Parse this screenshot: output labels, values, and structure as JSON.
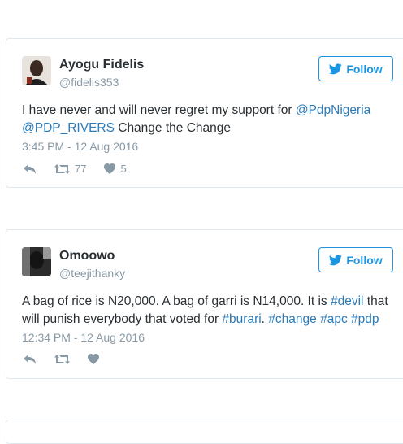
{
  "tweets": [
    {
      "name": "Ayogu Fidelis",
      "handle": "@fidelis353",
      "follow_label": "Follow",
      "text_parts": [
        {
          "t": "I have never and will never regret my support for ",
          "link": false
        },
        {
          "t": "@PdpNigeria",
          "link": true
        },
        {
          "t": " ",
          "link": false
        },
        {
          "t": "@PDP_RIVERS",
          "link": true
        },
        {
          "t": " Change the Change",
          "link": false
        }
      ],
      "time": "3:45 PM - 12 Aug 2016",
      "retweets": "77",
      "likes": "5"
    },
    {
      "name": "Omoowo",
      "handle": "@teejithanky",
      "follow_label": "Follow",
      "text_parts": [
        {
          "t": "A bag of rice is N20,000. A bag of garri is N14,000. It is ",
          "link": false
        },
        {
          "t": "#devil",
          "link": true
        },
        {
          "t": " that will punish everybody that voted for ",
          "link": false
        },
        {
          "t": "#burari",
          "link": true
        },
        {
          "t": ". ",
          "link": false
        },
        {
          "t": "#change",
          "link": true
        },
        {
          "t": " ",
          "link": false
        },
        {
          "t": "#apc",
          "link": true
        },
        {
          "t": " ",
          "link": false
        },
        {
          "t": "#pdp",
          "link": true
        }
      ],
      "time": "12:34 PM - 12 Aug 2016",
      "retweets": "",
      "likes": ""
    }
  ],
  "icons": {
    "follow": "twitter-bird-icon",
    "reply": "reply-icon",
    "retweet": "retweet-icon",
    "like": "heart-icon"
  },
  "colors": {
    "link": "#2b7bb9",
    "follow": "#1b95e0",
    "muted": "#8899a6",
    "border": "#e1e8ed"
  }
}
